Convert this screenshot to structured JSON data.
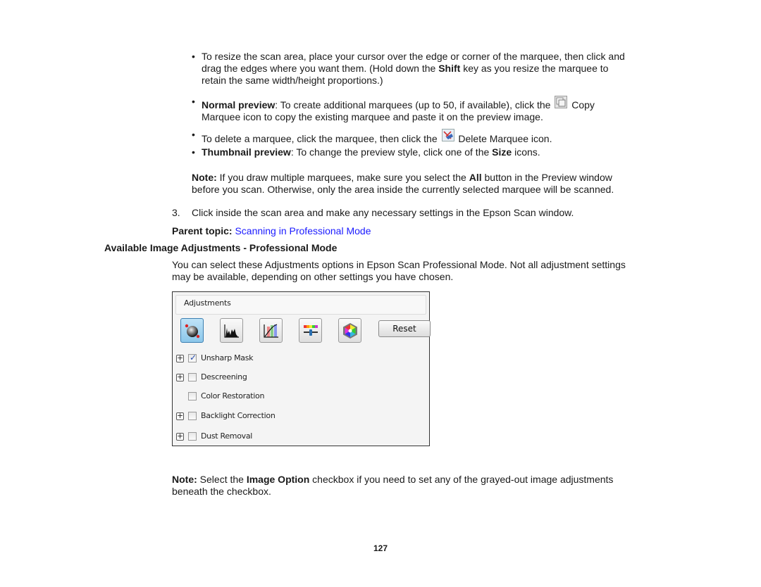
{
  "bullets": [
    {
      "lines": [
        {
          "parts": [
            {
              "t": "To resize the scan area, place your cursor over the edge or corner of the marquee, then click and"
            }
          ]
        },
        {
          "parts": [
            {
              "t": "drag the edges where you want them. (Hold down the "
            },
            {
              "t": "Shift",
              "b": true
            },
            {
              "t": " key as you resize the marquee to"
            }
          ]
        },
        {
          "parts": [
            {
              "t": "retain the same width/height proportions.)"
            }
          ]
        }
      ]
    },
    {
      "lines": [
        {
          "parts": [
            {
              "t": "Normal preview",
              "b": true
            },
            {
              "t": ": To create additional marquees (up to 50, if available), click the "
            },
            {
              "icon": "copy-marquee-icon"
            },
            {
              "t": " Copy"
            }
          ]
        },
        {
          "parts": [
            {
              "t": "Marquee icon to copy the existing marquee and paste it on the preview image."
            }
          ]
        }
      ]
    },
    {
      "lines": [
        {
          "parts": [
            {
              "t": "To delete a marquee, click the marquee, then click the "
            },
            {
              "icon": "delete-marquee-icon"
            },
            {
              "t": " Delete Marquee icon."
            }
          ]
        }
      ]
    },
    {
      "lines": [
        {
          "parts": [
            {
              "t": "Thumbnail preview",
              "b": true
            },
            {
              "t": ": To change the preview style, click one of the "
            },
            {
              "t": "Size",
              "b": true
            },
            {
              "t": " icons."
            }
          ]
        }
      ]
    }
  ],
  "bullet_char": "•",
  "note1": {
    "label": "Note:",
    "line1_a": " If you draw multiple marquees, make sure you select the ",
    "line1_bold": "All",
    "line1_b": " button in the Preview window",
    "line2": "before you scan. Otherwise, only the area inside the currently selected marquee will be scanned."
  },
  "step3": {
    "number": "3.",
    "text": "Click inside the scan area and make any necessary settings in the Epson Scan window."
  },
  "parent_topic": {
    "label": "Parent topic:",
    "link": "Scanning in Professional Mode",
    "link_color": "#1a1aff"
  },
  "section": {
    "heading": "Available Image Adjustments - Professional Mode",
    "intro_line1": "You can select these Adjustments options in Epson Scan Professional Mode. Not all adjustment settings",
    "intro_line2": "may be available, depending on other settings you have chosen."
  },
  "panel": {
    "title": "Adjustments",
    "tools": [
      {
        "name": "auto-exposure-tool",
        "active": true
      },
      {
        "name": "histogram-adjustment-tool",
        "active": false
      },
      {
        "name": "tone-correction-tool",
        "active": false
      },
      {
        "name": "image-adjustment-tool",
        "active": false
      },
      {
        "name": "color-palette-tool",
        "active": false
      }
    ],
    "reset_label": "Reset",
    "options": [
      {
        "label": "Unsharp Mask",
        "checked": true,
        "expandable": true
      },
      {
        "label": "Descreening",
        "checked": false,
        "expandable": true
      },
      {
        "label": "Color Restoration",
        "checked": false,
        "expandable": false
      },
      {
        "label": "Backlight Correction",
        "checked": false,
        "expandable": true
      },
      {
        "label": "Dust Removal",
        "checked": false,
        "expandable": true
      }
    ]
  },
  "note2": {
    "label": "Note:",
    "a": " Select the ",
    "bold": "Image Option",
    "b": " checkbox if you need to set any of the grayed-out image adjustments",
    "line2": "beneath the checkbox."
  },
  "page_number": "127"
}
